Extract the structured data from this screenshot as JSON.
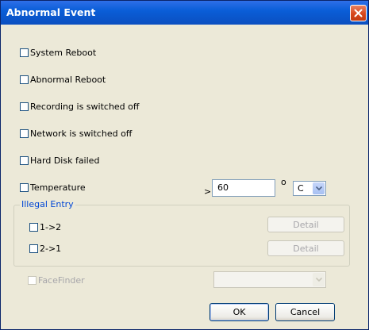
{
  "window": {
    "title": "Abnormal Event"
  },
  "events": [
    {
      "label": "System Reboot",
      "checked": false
    },
    {
      "label": "Abnormal Reboot",
      "checked": false
    },
    {
      "label": "Recording is switched off",
      "checked": false
    },
    {
      "label": "Network is switched off",
      "checked": false
    },
    {
      "label": "Hard Disk failed",
      "checked": false
    },
    {
      "label": "Temperature",
      "checked": false
    }
  ],
  "temperature": {
    "operator": ">",
    "value": "60",
    "degree_symbol": "o",
    "unit": "C"
  },
  "illegal_entry": {
    "legend": "Illegal Entry",
    "rows": [
      {
        "label": "1->2",
        "button": "Detail"
      },
      {
        "label": "2->1",
        "button": "Detail"
      }
    ]
  },
  "facefinder": {
    "label": "FaceFinder",
    "value": ""
  },
  "buttons": {
    "ok": "OK",
    "cancel": "Cancel"
  },
  "colors": {
    "title_bar": "#0a5ed8",
    "legend_text": "#0046d5",
    "close_button": "#d8461c"
  }
}
